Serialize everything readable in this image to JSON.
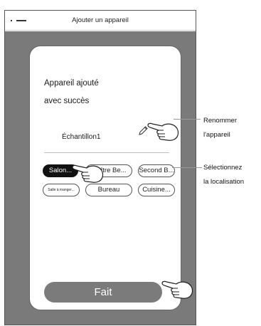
{
  "header": {
    "title": "Ajouter un appareil"
  },
  "card": {
    "success_line1": "Appareil ajouté",
    "success_line2": "avec succès",
    "device_name": "Échantillon1"
  },
  "locations": [
    {
      "label": "Salon...",
      "selected": true
    },
    {
      "label": "Maître Be...",
      "selected": false
    },
    {
      "label": "Second B...",
      "selected": false
    },
    {
      "label": "Salle à manger...",
      "selected": false
    },
    {
      "label": "Bureau",
      "selected": false
    },
    {
      "label": "Cuisine...",
      "selected": false
    }
  ],
  "done_button": {
    "label": "Fait"
  },
  "annotations": {
    "rename": {
      "line1": "Renommer",
      "line2": "l'appareil"
    },
    "location": {
      "line1": "Sélectionnez",
      "line2": "la localisation"
    }
  },
  "colors": {
    "background_overlay": "#7a7a7a",
    "selected_chip": "#111111",
    "done_button": "#7b7b7b"
  }
}
